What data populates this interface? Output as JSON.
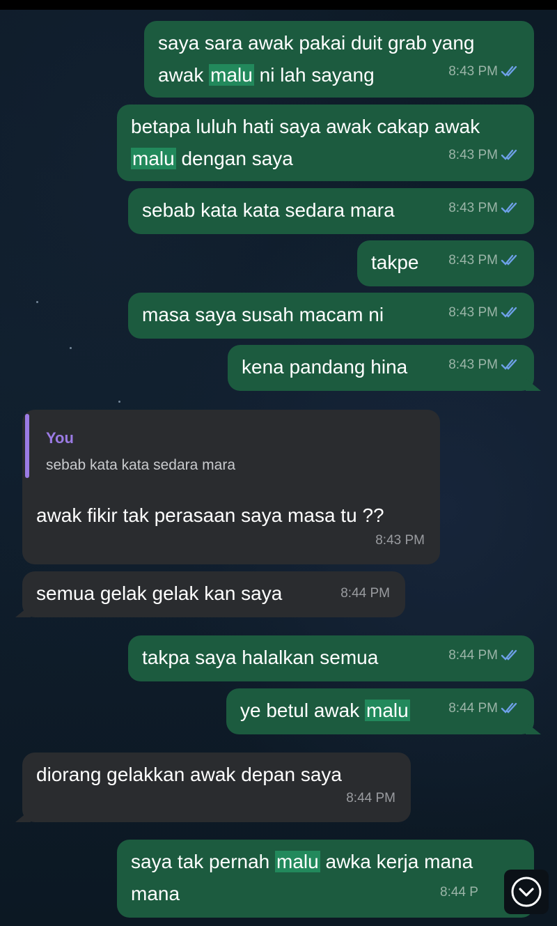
{
  "ticks_icon": "double-check-icon",
  "scroll_icon": "chevron-down-circle-icon",
  "colors": {
    "outgoing_bubble": "#1c5b3f",
    "incoming_bubble": "#2a2c2f",
    "highlight": "#22895c",
    "reply_accent": "#9b7be4",
    "read_ticks": "#6ea0e8"
  },
  "messages": [
    {
      "line1_a": "saya sara awak pakai duit grab yang",
      "line2_a": "awak ",
      "line2_hl": "malu",
      "line2_b": " ni lah sayang",
      "time": "8:43 PM"
    },
    {
      "line1_a": "betapa luluh hati saya awak cakap awak",
      "line2_hl": "malu",
      "line2_b": " dengan saya",
      "time": "8:43 PM"
    },
    {
      "text": "sebab kata kata sedara mara",
      "time": "8:43 PM"
    },
    {
      "text": "takpe",
      "time": "8:43 PM"
    },
    {
      "text": "masa saya susah macam ni",
      "time": "8:43 PM"
    },
    {
      "text": "kena pandang hina",
      "time": "8:43 PM"
    },
    {
      "reply_author": "You",
      "reply_text": "sebab kata kata sedara mara",
      "text": "awak fikir tak perasaan saya masa tu ??",
      "time": "8:43 PM"
    },
    {
      "text": "semua gelak gelak kan saya",
      "time": "8:44 PM"
    },
    {
      "text": "takpa saya halalkan semua",
      "time": "8:44 PM"
    },
    {
      "text_a": "ye betul awak ",
      "text_hl": "malu",
      "time": "8:44 PM"
    },
    {
      "text": "diorang gelakkan awak depan saya",
      "time": "8:44 PM"
    },
    {
      "line1_a": "saya tak pernah ",
      "line1_hl": "malu",
      "line1_b": " awka kerja mana",
      "line2": "mana",
      "time": "8:44 P"
    }
  ]
}
